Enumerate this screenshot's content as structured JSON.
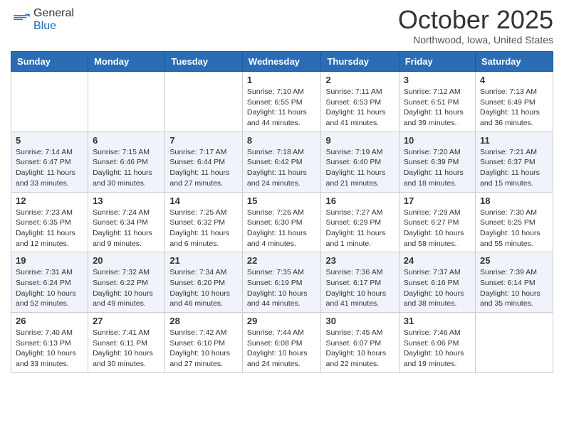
{
  "header": {
    "logo_general": "General",
    "logo_blue": "Blue",
    "month": "October 2025",
    "location": "Northwood, Iowa, United States"
  },
  "weekdays": [
    "Sunday",
    "Monday",
    "Tuesday",
    "Wednesday",
    "Thursday",
    "Friday",
    "Saturday"
  ],
  "weeks": [
    [
      {
        "day": "",
        "info": ""
      },
      {
        "day": "",
        "info": ""
      },
      {
        "day": "",
        "info": ""
      },
      {
        "day": "1",
        "info": "Sunrise: 7:10 AM\nSunset: 6:55 PM\nDaylight: 11 hours and 44 minutes."
      },
      {
        "day": "2",
        "info": "Sunrise: 7:11 AM\nSunset: 6:53 PM\nDaylight: 11 hours and 41 minutes."
      },
      {
        "day": "3",
        "info": "Sunrise: 7:12 AM\nSunset: 6:51 PM\nDaylight: 11 hours and 39 minutes."
      },
      {
        "day": "4",
        "info": "Sunrise: 7:13 AM\nSunset: 6:49 PM\nDaylight: 11 hours and 36 minutes."
      }
    ],
    [
      {
        "day": "5",
        "info": "Sunrise: 7:14 AM\nSunset: 6:47 PM\nDaylight: 11 hours and 33 minutes."
      },
      {
        "day": "6",
        "info": "Sunrise: 7:15 AM\nSunset: 6:46 PM\nDaylight: 11 hours and 30 minutes."
      },
      {
        "day": "7",
        "info": "Sunrise: 7:17 AM\nSunset: 6:44 PM\nDaylight: 11 hours and 27 minutes."
      },
      {
        "day": "8",
        "info": "Sunrise: 7:18 AM\nSunset: 6:42 PM\nDaylight: 11 hours and 24 minutes."
      },
      {
        "day": "9",
        "info": "Sunrise: 7:19 AM\nSunset: 6:40 PM\nDaylight: 11 hours and 21 minutes."
      },
      {
        "day": "10",
        "info": "Sunrise: 7:20 AM\nSunset: 6:39 PM\nDaylight: 11 hours and 18 minutes."
      },
      {
        "day": "11",
        "info": "Sunrise: 7:21 AM\nSunset: 6:37 PM\nDaylight: 11 hours and 15 minutes."
      }
    ],
    [
      {
        "day": "12",
        "info": "Sunrise: 7:23 AM\nSunset: 6:35 PM\nDaylight: 11 hours and 12 minutes."
      },
      {
        "day": "13",
        "info": "Sunrise: 7:24 AM\nSunset: 6:34 PM\nDaylight: 11 hours and 9 minutes."
      },
      {
        "day": "14",
        "info": "Sunrise: 7:25 AM\nSunset: 6:32 PM\nDaylight: 11 hours and 6 minutes."
      },
      {
        "day": "15",
        "info": "Sunrise: 7:26 AM\nSunset: 6:30 PM\nDaylight: 11 hours and 4 minutes."
      },
      {
        "day": "16",
        "info": "Sunrise: 7:27 AM\nSunset: 6:29 PM\nDaylight: 11 hours and 1 minute."
      },
      {
        "day": "17",
        "info": "Sunrise: 7:29 AM\nSunset: 6:27 PM\nDaylight: 10 hours and 58 minutes."
      },
      {
        "day": "18",
        "info": "Sunrise: 7:30 AM\nSunset: 6:25 PM\nDaylight: 10 hours and 55 minutes."
      }
    ],
    [
      {
        "day": "19",
        "info": "Sunrise: 7:31 AM\nSunset: 6:24 PM\nDaylight: 10 hours and 52 minutes."
      },
      {
        "day": "20",
        "info": "Sunrise: 7:32 AM\nSunset: 6:22 PM\nDaylight: 10 hours and 49 minutes."
      },
      {
        "day": "21",
        "info": "Sunrise: 7:34 AM\nSunset: 6:20 PM\nDaylight: 10 hours and 46 minutes."
      },
      {
        "day": "22",
        "info": "Sunrise: 7:35 AM\nSunset: 6:19 PM\nDaylight: 10 hours and 44 minutes."
      },
      {
        "day": "23",
        "info": "Sunrise: 7:36 AM\nSunset: 6:17 PM\nDaylight: 10 hours and 41 minutes."
      },
      {
        "day": "24",
        "info": "Sunrise: 7:37 AM\nSunset: 6:16 PM\nDaylight: 10 hours and 38 minutes."
      },
      {
        "day": "25",
        "info": "Sunrise: 7:39 AM\nSunset: 6:14 PM\nDaylight: 10 hours and 35 minutes."
      }
    ],
    [
      {
        "day": "26",
        "info": "Sunrise: 7:40 AM\nSunset: 6:13 PM\nDaylight: 10 hours and 33 minutes."
      },
      {
        "day": "27",
        "info": "Sunrise: 7:41 AM\nSunset: 6:11 PM\nDaylight: 10 hours and 30 minutes."
      },
      {
        "day": "28",
        "info": "Sunrise: 7:42 AM\nSunset: 6:10 PM\nDaylight: 10 hours and 27 minutes."
      },
      {
        "day": "29",
        "info": "Sunrise: 7:44 AM\nSunset: 6:08 PM\nDaylight: 10 hours and 24 minutes."
      },
      {
        "day": "30",
        "info": "Sunrise: 7:45 AM\nSunset: 6:07 PM\nDaylight: 10 hours and 22 minutes."
      },
      {
        "day": "31",
        "info": "Sunrise: 7:46 AM\nSunset: 6:06 PM\nDaylight: 10 hours and 19 minutes."
      },
      {
        "day": "",
        "info": ""
      }
    ]
  ]
}
